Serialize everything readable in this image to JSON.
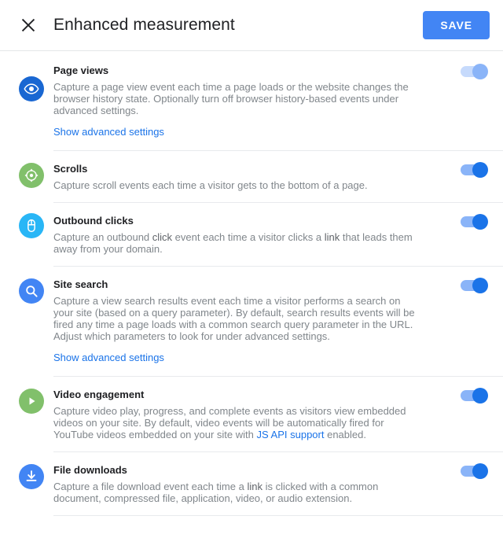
{
  "header": {
    "close_icon": "close-icon",
    "title": "Enhanced measurement",
    "save_label": "SAVE",
    "save_color": "#4285f4"
  },
  "colors": {
    "link": "#1a73e8",
    "toggle_on_knob": "#1a73e8",
    "toggle_on_track": "#8ab4f8",
    "toggle_locked_knob": "#8ab4f8",
    "toggle_locked_track": "#c6dafc",
    "title_text": "#202124",
    "body_text": "#80868b",
    "divider": "#e8eaed"
  },
  "settings": [
    {
      "id": "page-views",
      "icon": "eye-icon",
      "icon_color": "#1967d2",
      "title": "Page views",
      "description_pre": "Capture a page view event each time a page loads or the website changes the browser history state. Optionally turn off browser history-based events under advanced settings.",
      "link_label": "Show advanced settings",
      "toggle_state": "on-locked"
    },
    {
      "id": "scrolls",
      "icon": "scroll-target-icon",
      "icon_color": "#81c06b",
      "title": "Scrolls",
      "description_pre": "Capture scroll events each time a visitor gets to the bottom of a page.",
      "link_label": "",
      "toggle_state": "on"
    },
    {
      "id": "outbound-clicks",
      "icon": "mouse-icon",
      "icon_color": "#29b6f6",
      "title": "Outbound clicks",
      "description_pre": "Capture an outbound ",
      "description_emph1": "click",
      "description_mid": " event each time a visitor clicks a ",
      "description_emph2": "link",
      "description_post": " that leads them away from your domain.",
      "link_label": "",
      "toggle_state": "on"
    },
    {
      "id": "site-search",
      "icon": "search-icon",
      "icon_color": "#4285f4",
      "title": "Site search",
      "description_pre": "Capture a view search results event each time a visitor performs a search on your site (based on a query parameter). By default, search results events will be fired any time a page loads with a common search query parameter in the URL. Adjust which parameters to look for under advanced settings.",
      "link_label": "Show advanced settings",
      "toggle_state": "on"
    },
    {
      "id": "video-engagement",
      "icon": "play-icon",
      "icon_color": "#81c06b",
      "title": "Video engagement",
      "description_pre": "Capture video play, progress, and complete events as visitors view embedded videos on your site. By default, video events will be automatically fired for YouTube videos embedded on your site with ",
      "description_link": "JS API support",
      "description_post": " enabled.",
      "link_label": "",
      "toggle_state": "on"
    },
    {
      "id": "file-downloads",
      "icon": "download-icon",
      "icon_color": "#4285f4",
      "title": "File downloads",
      "description_pre": "Capture a file download event each time a ",
      "description_emph1": "link",
      "description_post": " is clicked with a common document, compressed file, application, video, or audio extension.",
      "link_label": "",
      "toggle_state": "on"
    }
  ]
}
